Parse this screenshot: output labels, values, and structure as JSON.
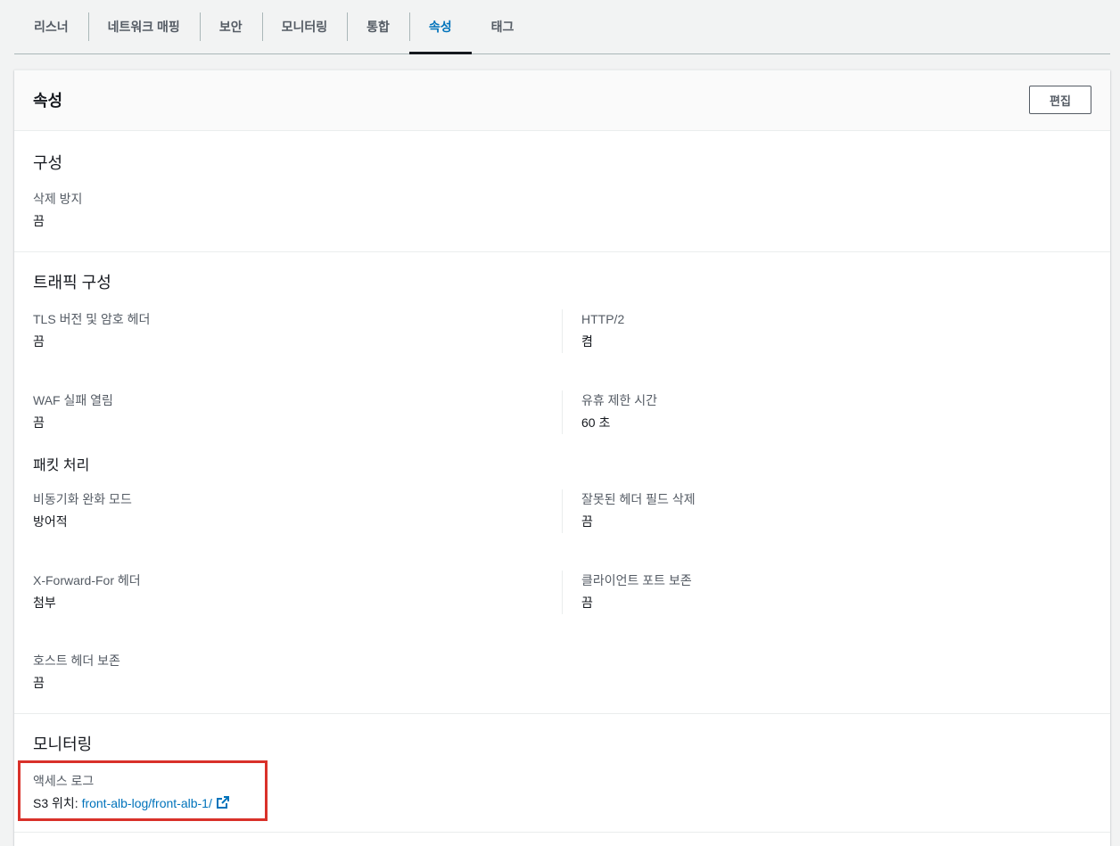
{
  "tabs": [
    {
      "label": "리스너"
    },
    {
      "label": "네트워크 매핑"
    },
    {
      "label": "보안"
    },
    {
      "label": "모니터링"
    },
    {
      "label": "통합"
    },
    {
      "label": "속성"
    },
    {
      "label": "태그"
    }
  ],
  "active_tab": "속성",
  "panel": {
    "title": "속성",
    "edit_label": "편집"
  },
  "configuration": {
    "title": "구성",
    "deletion_protection": {
      "label": "삭제 방지",
      "value": "끔"
    }
  },
  "traffic": {
    "title": "트래픽 구성",
    "tls_headers": {
      "label": "TLS 버전 및 암호 헤더",
      "value": "끔"
    },
    "http2": {
      "label": "HTTP/2",
      "value": "켬"
    },
    "waf_fail_open": {
      "label": "WAF 실패 열림",
      "value": "끔"
    },
    "idle_timeout": {
      "label": "유휴 제한 시간",
      "value": "60 초"
    }
  },
  "packet": {
    "title": "패킷 처리",
    "desync_mode": {
      "label": "비동기화 완화 모드",
      "value": "방어적"
    },
    "drop_invalid_headers": {
      "label": "잘못된 헤더 필드 삭제",
      "value": "끔"
    },
    "xff_header": {
      "label": "X-Forward-For 헤더",
      "value": "첨부"
    },
    "client_port": {
      "label": "클라이언트 포트 보존",
      "value": "끔"
    },
    "host_header": {
      "label": "호스트 헤더 보존",
      "value": "끔"
    }
  },
  "monitoring": {
    "title": "모니터링",
    "access_logs": {
      "label": "액세스 로그",
      "prefix": "S3 위치: ",
      "link": "front-alb-log/front-alb-1/"
    }
  },
  "colors": {
    "accent": "#0073bb",
    "highlight": "#d9312a"
  }
}
